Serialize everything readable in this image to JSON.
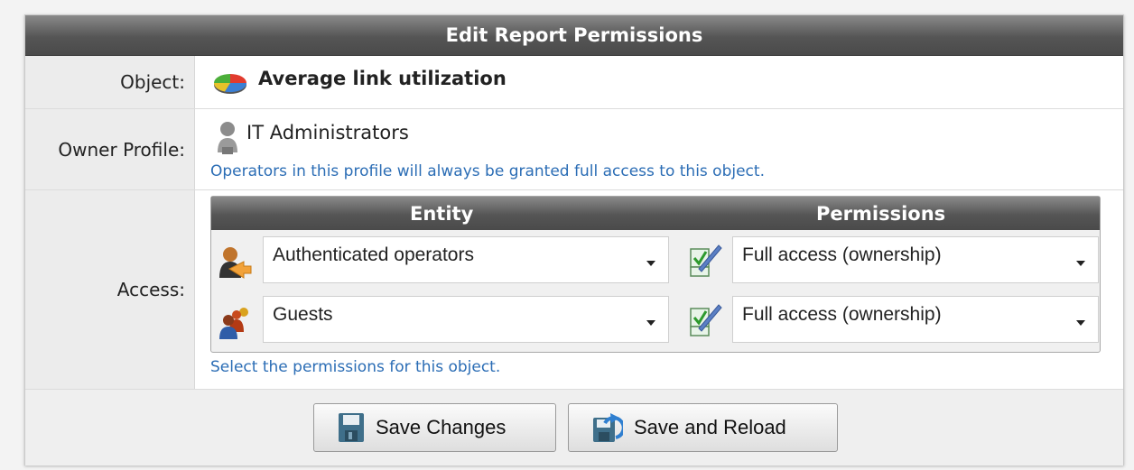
{
  "dialog": {
    "title": "Edit Report Permissions"
  },
  "object": {
    "label": "Object:",
    "name": "Average link utilization",
    "icon": "pie-chart-icon"
  },
  "owner": {
    "label": "Owner Profile:",
    "name": "IT Administrators",
    "icon": "person-profile-icon",
    "hint": "Operators in this profile will always be granted full access to this object."
  },
  "access": {
    "label": "Access:",
    "columns": {
      "entity": "Entity",
      "permissions": "Permissions"
    },
    "rows": [
      {
        "entity": "Authenticated operators",
        "entity_icon": "authenticated-operator-icon",
        "permission": "Full access (ownership)",
        "permission_icon": "check-pen-icon"
      },
      {
        "entity": "Guests",
        "entity_icon": "guests-group-icon",
        "permission": "Full access (ownership)",
        "permission_icon": "check-pen-icon"
      }
    ],
    "hint": "Select the permissions for this object."
  },
  "buttons": {
    "save": "Save Changes",
    "reload": "Save and Reload"
  }
}
